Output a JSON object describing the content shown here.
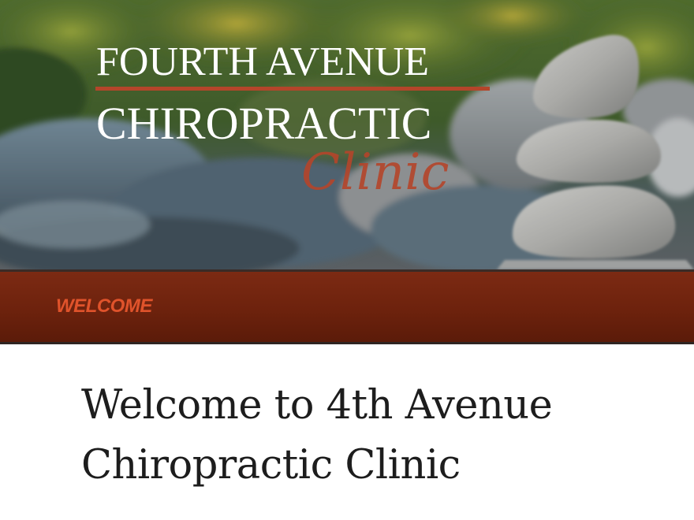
{
  "header": {
    "logo_line1": "FOURTH AVENUE",
    "logo_line2": "CHIROPRACTIC",
    "logo_script": "Clinic",
    "logo_text_color": "#ffffff",
    "logo_accent_color": "#b4452a"
  },
  "nav": {
    "items": [
      {
        "label": "WELCOME",
        "active": true
      }
    ],
    "bar_color": "#6d220d",
    "link_color": "#e0532b"
  },
  "main": {
    "title": "Welcome to 4th Avenue Chiropractic Clinic"
  }
}
